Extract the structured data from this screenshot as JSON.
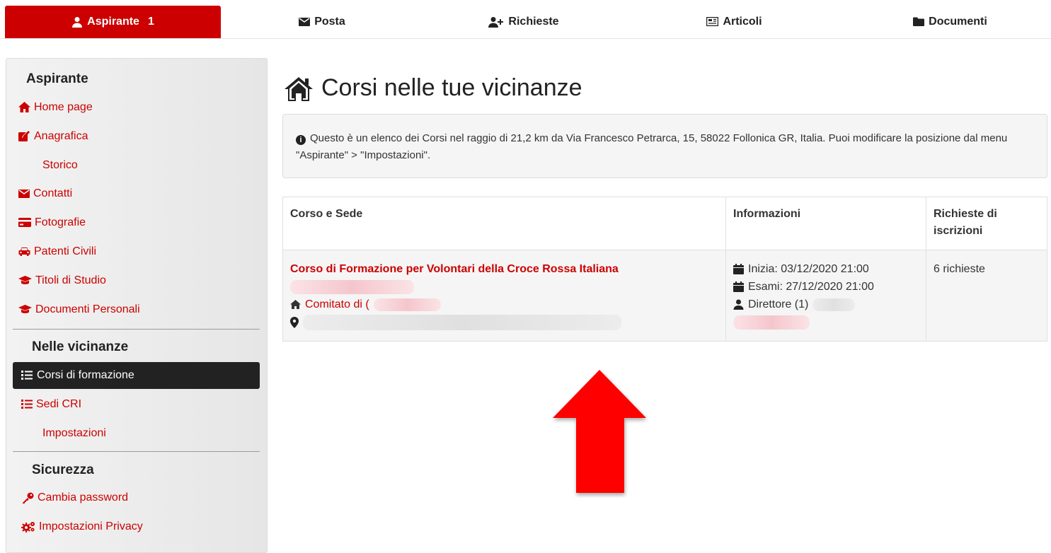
{
  "topnav": {
    "items": [
      {
        "label": "Aspirante",
        "count": "1",
        "icon": "user-icon"
      },
      {
        "label": "Posta",
        "icon": "envelope-icon"
      },
      {
        "label": "Richieste",
        "icon": "user-plus-icon"
      },
      {
        "label": "Articoli",
        "icon": "newspaper-icon"
      },
      {
        "label": "Documenti",
        "icon": "folder-icon"
      }
    ]
  },
  "sidebar": {
    "sections": [
      {
        "title": "Aspirante"
      },
      {
        "title": "Nelle vicinanze"
      },
      {
        "title": "Sicurezza"
      }
    ],
    "items": [
      {
        "label": "Home page",
        "icon": "home-icon"
      },
      {
        "label": "Anagrafica",
        "icon": "edit-icon"
      },
      {
        "label": "Storico"
      },
      {
        "label": "Contatti",
        "icon": "envelope-icon"
      },
      {
        "label": "Fotografie",
        "icon": "credit-card-icon"
      },
      {
        "label": "Patenti Civili",
        "icon": "car-icon"
      },
      {
        "label": "Titoli di Studio",
        "icon": "graduation-cap-icon"
      },
      {
        "label": "Documenti Personali",
        "icon": "graduation-cap-icon"
      },
      {
        "label": "Corsi di formazione",
        "icon": "list-icon"
      },
      {
        "label": "Sedi CRI",
        "icon": "list-icon"
      },
      {
        "label": "Impostazioni"
      },
      {
        "label": "Cambia password",
        "icon": "key-icon"
      },
      {
        "label": "Impostazioni Privacy",
        "icon": "gears-icon"
      }
    ]
  },
  "page": {
    "title": "Corsi nelle tue vicinanze",
    "info_text": "Questo è un elenco dei Corsi nel raggio di 21,2 km da Via Francesco Petrarca, 15, 58022 Follonica GR, Italia. Puoi modificare la posizione dal menu \"Aspirante\" > \"Impostazioni\"."
  },
  "table": {
    "headers": [
      "Corso e Sede",
      "Informazioni",
      "Richieste di iscrizioni"
    ],
    "row": {
      "course_title": "Corso di Formazione per Volontari della Croce Rossa Italiana",
      "committee_prefix": "Comitato di (",
      "start": "Inizia: 03/12/2020 21:00",
      "exams": "Esami: 27/12/2020 21:00",
      "director": "Direttore (1)",
      "requests": "6 richieste"
    }
  },
  "colors": {
    "accent": "#cc0000",
    "active_bg": "#222222",
    "arrow": "#ff0000"
  }
}
